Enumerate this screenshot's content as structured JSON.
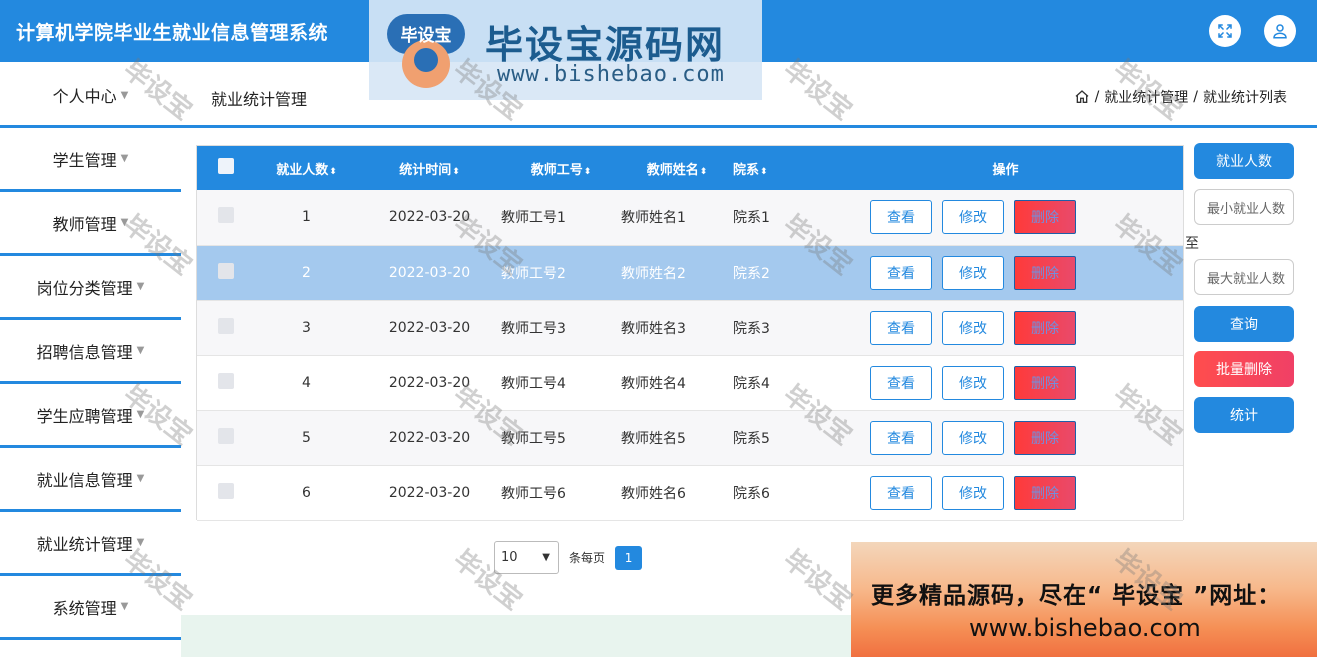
{
  "header": {
    "app_title": "计算机学院毕业生就业信息管理系统",
    "fullscreen_icon": "expand-icon",
    "user_icon": "user-icon"
  },
  "logo": {
    "badge_text": "毕设宝",
    "name": "毕设宝源码网",
    "url": "www.bishebao.com"
  },
  "nav": {
    "personal_center": "个人中心",
    "page_title": "就业统计管理",
    "breadcrumb": [
      "就业统计管理",
      "就业统计列表"
    ],
    "separator": "/"
  },
  "sidebar": {
    "items": [
      {
        "label": "学生管理"
      },
      {
        "label": "教师管理"
      },
      {
        "label": "岗位分类管理"
      },
      {
        "label": "招聘信息管理"
      },
      {
        "label": "学生应聘管理"
      },
      {
        "label": "就业信息管理"
      },
      {
        "label": "就业统计管理"
      },
      {
        "label": "系统管理"
      }
    ]
  },
  "table": {
    "columns": [
      "就业人数",
      "统计时间",
      "教师工号",
      "教师姓名",
      "院系",
      "操作"
    ],
    "sort_glyph": "⬍",
    "rows": [
      {
        "count": "1",
        "time": "2022-03-20",
        "teacher_id": "教师工号1",
        "teacher_name": "教师姓名1",
        "dept": "院系1"
      },
      {
        "count": "2",
        "time": "2022-03-20",
        "teacher_id": "教师工号2",
        "teacher_name": "教师姓名2",
        "dept": "院系2"
      },
      {
        "count": "3",
        "time": "2022-03-20",
        "teacher_id": "教师工号3",
        "teacher_name": "教师姓名3",
        "dept": "院系3"
      },
      {
        "count": "4",
        "time": "2022-03-20",
        "teacher_id": "教师工号4",
        "teacher_name": "教师姓名4",
        "dept": "院系4"
      },
      {
        "count": "5",
        "time": "2022-03-20",
        "teacher_id": "教师工号5",
        "teacher_name": "教师姓名5",
        "dept": "院系5"
      },
      {
        "count": "6",
        "time": "2022-03-20",
        "teacher_id": "教师工号6",
        "teacher_name": "教师姓名6",
        "dept": "院系6"
      }
    ],
    "actions": {
      "view": "查看",
      "edit": "修改",
      "delete": "删除"
    }
  },
  "search_panel": {
    "field_label": "就业人数",
    "min_placeholder": "最小就业人数",
    "to": "至",
    "max_placeholder": "最大就业人数",
    "query": "查询",
    "batch_delete": "批量删除",
    "stats": "统计"
  },
  "pagination": {
    "page_size": "10",
    "per_page_label": "条每页",
    "current_page": "1"
  },
  "promo": {
    "line1": "更多精品源码，尽在“ 毕设宝 ”网址：",
    "line2": "www.bishebao.com"
  },
  "watermark": "毕设宝",
  "colors": {
    "primary": "#2389df",
    "danger": "#ff4d4d",
    "selected_row": "#a4c9ee"
  }
}
